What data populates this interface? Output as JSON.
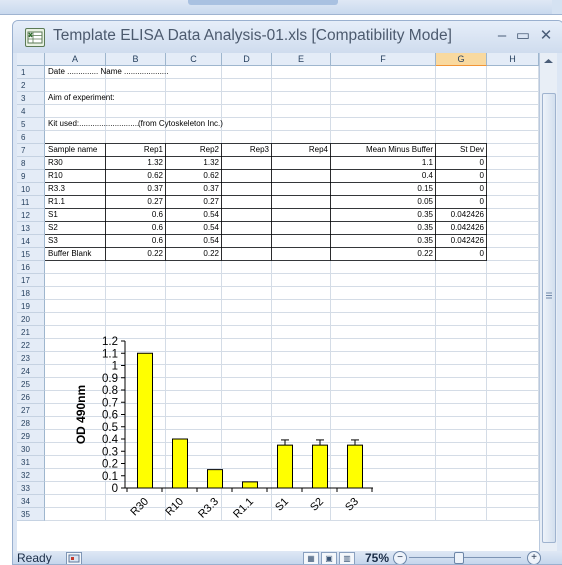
{
  "window": {
    "title": "Template ELISA Data Analysis-01.xls  [Compatibility Mode]",
    "minimize_glyph": "–",
    "maximize_glyph": "▭",
    "close_glyph": "✕",
    "icon": "excel-workbook-icon"
  },
  "columns": [
    "A",
    "B",
    "C",
    "D",
    "E",
    "F",
    "G",
    "H"
  ],
  "selected_column": "G",
  "row_numbers": [
    "1",
    "2",
    "3",
    "4",
    "5",
    "6",
    "7",
    "8",
    "9",
    "10",
    "11",
    "12",
    "13",
    "14",
    "15",
    "16",
    "17",
    "18",
    "19",
    "20",
    "21",
    "22",
    "23",
    "24",
    "25",
    "26",
    "27",
    "28",
    "29",
    "30",
    "31",
    "32",
    "33",
    "34",
    "35"
  ],
  "header_cells": {
    "date_label": "Date .............. Name ....................",
    "aim_label": "Aim of experiment:",
    "kit_label": "Kit used:...........................",
    "kit_source": "(from Cytoskeleton Inc.)"
  },
  "table": {
    "headers": [
      "Sample name",
      "Rep1",
      "Rep2",
      "Rep3",
      "Rep4",
      "Mean Minus Buffer",
      "St Dev"
    ],
    "rows": [
      [
        "R30",
        "1.32",
        "1.32",
        "",
        "",
        "1.1",
        "0"
      ],
      [
        "R10",
        "0.62",
        "0.62",
        "",
        "",
        "0.4",
        "0"
      ],
      [
        "R3.3",
        "0.37",
        "0.37",
        "",
        "",
        "0.15",
        "0"
      ],
      [
        "R1.1",
        "0.27",
        "0.27",
        "",
        "",
        "0.05",
        "0"
      ],
      [
        "S1",
        "0.6",
        "0.54",
        "",
        "",
        "0.35",
        "0.042426"
      ],
      [
        "S2",
        "0.6",
        "0.54",
        "",
        "",
        "0.35",
        "0.042426"
      ],
      [
        "S3",
        "0.6",
        "0.54",
        "",
        "",
        "0.35",
        "0.042426"
      ],
      [
        "Buffer Blank",
        "0.22",
        "0.22",
        "",
        "",
        "0.22",
        "0"
      ]
    ]
  },
  "chart_data": {
    "type": "bar",
    "categories": [
      "R30",
      "R10",
      "R3.3",
      "R1.1",
      "S1",
      "S2",
      "S3"
    ],
    "values": [
      1.1,
      0.4,
      0.15,
      0.05,
      0.35,
      0.35,
      0.35
    ],
    "error": [
      0,
      0,
      0,
      0,
      0.042426,
      0.042426,
      0.042426
    ],
    "ylabel": "OD 490nm",
    "yticks": [
      "0",
      "0.1",
      "0.2",
      "0.3",
      "0.4",
      "0.5",
      "0.6",
      "0.7",
      "0.8",
      "0.9",
      "1",
      "1.1",
      "1.2"
    ],
    "ylim": [
      0,
      1.2
    ],
    "bar_color": "#ffff00",
    "grid": false
  },
  "status": {
    "ready": "Ready",
    "zoom": "75%",
    "zoom_out": "−",
    "zoom_in": "+",
    "view_normal": "▦",
    "view_page_layout": "▣",
    "view_page_break": "▥"
  },
  "colors": {
    "header_bg": "#e4ecf7",
    "selected_header": "#f9d99f",
    "bar": "#ffff00"
  }
}
